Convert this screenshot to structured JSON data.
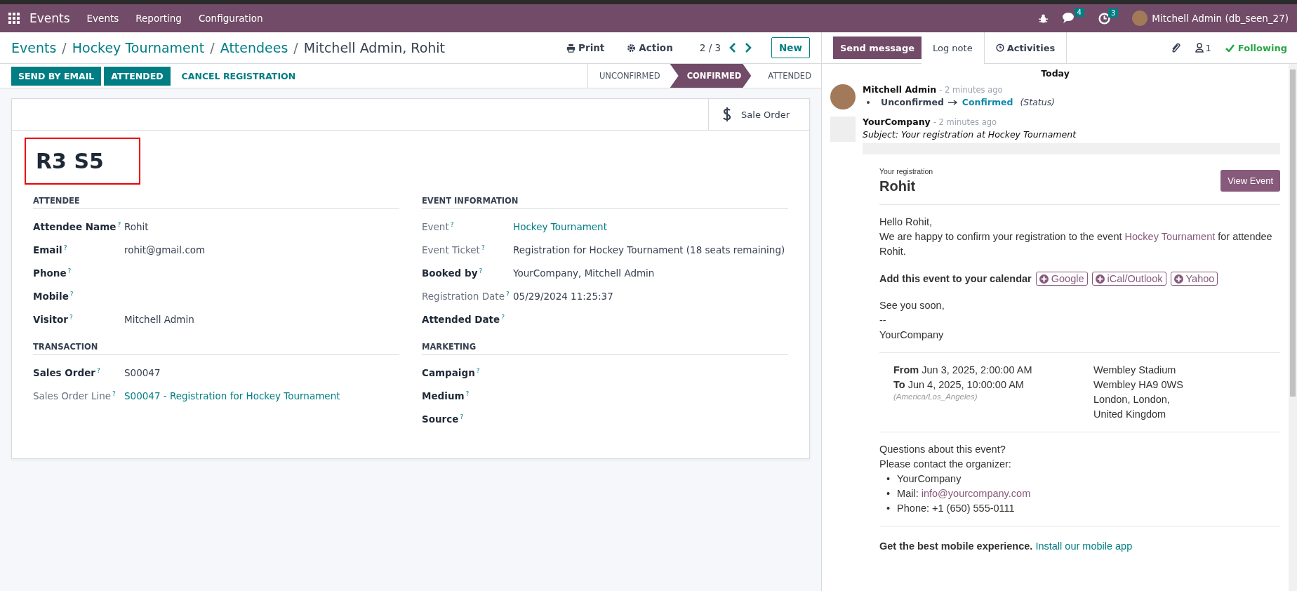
{
  "navbar": {
    "app_title": "Events",
    "menus": [
      "Events",
      "Reporting",
      "Configuration"
    ],
    "chat_count": "4",
    "activity_count": "3",
    "user": "Mitchell Admin (db_seen_27)"
  },
  "breadcrumbs": [
    {
      "label": "Events"
    },
    {
      "separator": "/",
      "label": "Hockey Tournament"
    },
    {
      "separator": "/",
      "label": "Attendees"
    },
    {
      "separator": "/",
      "label": "Mitchell Admin, Rohit"
    }
  ],
  "toolbar": {
    "print": "Print",
    "action": "Action",
    "pager": "2 / 3",
    "new": "New"
  },
  "action_buttons": [
    {
      "label": "SEND BY EMAIL",
      "kind": "primary"
    },
    {
      "label": "ATTENDED",
      "kind": "primary"
    },
    {
      "label": "CANCEL REGISTRATION",
      "kind": "link"
    }
  ],
  "statusbar": [
    {
      "label": "UNCONFIRMED",
      "selected": false
    },
    {
      "label": "CONFIRMED",
      "selected": true
    },
    {
      "label": "ATTENDED",
      "selected": false
    }
  ],
  "smart_button": "Sale Order",
  "title": "R3 S5",
  "groups": [
    {
      "title": "ATTENDEE",
      "fields": [
        {
          "label": "Attendee Name",
          "help": "?",
          "value": "Rohit",
          "kind": "text",
          "readonly": false
        },
        {
          "label": "Email",
          "help": "?",
          "value": "rohit@gmail.com",
          "kind": "text",
          "readonly": false
        },
        {
          "label": "Phone",
          "help": "?",
          "readonly": false
        },
        {
          "label": "Mobile",
          "help": "?",
          "readonly": false
        },
        {
          "label": "Visitor",
          "help": "?",
          "value": "Mitchell Admin",
          "kind": "text",
          "readonly": false
        }
      ]
    },
    {
      "title": "EVENT INFORMATION",
      "fields": [
        {
          "label": "Event",
          "help": "?",
          "value": "Hockey Tournament",
          "kind": "link",
          "readonly": true
        },
        {
          "label": "Event Ticket",
          "help": "?",
          "value": "Registration for Hockey Tournament (18 seats remaining)",
          "kind": "text",
          "readonly": true
        },
        {
          "label": "Booked by",
          "help": "?",
          "value": "YourCompany, Mitchell Admin",
          "kind": "text",
          "readonly": false
        },
        {
          "label": "Registration Date",
          "help": "?",
          "value": "05/29/2024 11:25:37",
          "kind": "text",
          "readonly": true
        },
        {
          "label": "Attended Date",
          "help": "?",
          "readonly": false
        }
      ]
    },
    {
      "title": "TRANSACTION",
      "fields": [
        {
          "label": "Sales Order",
          "help": "?",
          "value": "S00047",
          "kind": "text",
          "readonly": false
        },
        {
          "label": "Sales Order Line",
          "help": "?",
          "value": "S00047 - Registration for Hockey Tournament",
          "kind": "link",
          "readonly": true
        }
      ]
    },
    {
      "title": "MARKETING",
      "fields": [
        {
          "label": "Campaign",
          "help": "?",
          "readonly": false
        },
        {
          "label": "Medium",
          "help": "?",
          "readonly": false
        },
        {
          "label": "Source",
          "help": "?",
          "readonly": false
        }
      ]
    }
  ],
  "chatter": {
    "buttons": [
      {
        "label": "Send message",
        "kind": "primary"
      },
      {
        "label": "Log note",
        "kind": "plain"
      },
      {
        "label": "Activities",
        "kind": "bordered"
      }
    ],
    "followers": "1",
    "following": "Following",
    "date_separator": "Today",
    "tracking_message": {
      "author": "Mitchell Admin",
      "time": "- 2 minutes ago",
      "old_value": "Unconfirmed",
      "new_value": "Confirmed",
      "field": "(Status)"
    },
    "email_message": {
      "author": "YourCompany",
      "time": "- 2 minutes ago",
      "subject": "Subject: Your registration at Hockey Tournament",
      "kicker": "Your registration",
      "name": "Rohit",
      "view_button": "View Event",
      "greeting": "Hello Rohit,",
      "intro": [
        "We are happy to confirm your registration to the event ",
        "Hockey Tournament",
        " for attendee Rohit."
      ],
      "calendar_label": "Add this event to your calendar",
      "calendar_buttons": [
        "Google",
        "iCal/Outlook",
        "Yahoo"
      ],
      "signoff": [
        "See you soon,",
        "--",
        "YourCompany"
      ],
      "from": "**From** Jun 3, 2025, 2:00:00 AM",
      "to": "**To** Jun 4, 2025, 10:00:00 AM",
      "timezone": "(America/Los_Angeles)",
      "address": [
        "Wembley Stadium",
        "Wembley HA9 0WS",
        "London, London,",
        "United Kingdom"
      ],
      "questions": [
        "Questions about this event?",
        "Please contact the organizer:"
      ],
      "contacts": [
        {
          "bullet": "•",
          "text": "YourCompany",
          "kind": "text"
        },
        {
          "bullet": "•",
          "text": "Mail: ",
          "link": "info@yourcompany.com",
          "kind": "link"
        },
        {
          "bullet": "•",
          "text": "Phone: +1 (650) 555-0111",
          "kind": "text"
        }
      ],
      "footer": "Get the best mobile experience.",
      "footer_link": "Install our mobile app"
    }
  }
}
